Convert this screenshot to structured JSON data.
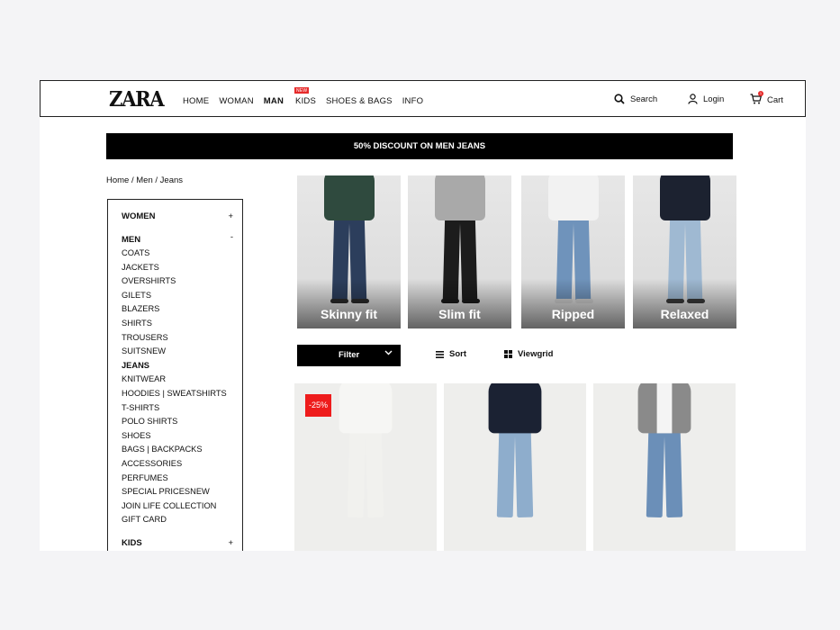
{
  "brand": "ZARA",
  "nav": {
    "items": [
      {
        "label": "HOME",
        "active": false
      },
      {
        "label": "WOMAN",
        "active": false
      },
      {
        "label": "MAN",
        "active": true
      },
      {
        "label": "KIDS",
        "active": false,
        "badge": "NEW"
      },
      {
        "label": "SHOES & BAGS",
        "active": false
      },
      {
        "label": "INFO",
        "active": false
      }
    ]
  },
  "header_actions": {
    "search": "Search",
    "login": "Login",
    "cart": "Cart",
    "cart_count": "1"
  },
  "promo": "50% DISCOUNT ON MEN JEANS",
  "breadcrumb": [
    "Home",
    "Men",
    "Jeans"
  ],
  "breadcrumb_sep": " / ",
  "sidebar": {
    "women": {
      "label": "WOMEN",
      "sign": "+"
    },
    "men": {
      "label": "MEN",
      "sign": "-"
    },
    "men_items": [
      "COATS",
      "JACKETS",
      "OVERSHIRTS",
      "GILETS",
      "BLAZERS",
      "SHIRTS",
      "TROUSERS",
      "SUITSNEW",
      "JEANS",
      "KNITWEAR",
      "HOODIES | SWEATSHIRTS",
      "T-SHIRTS",
      "POLO SHIRTS",
      "SHOES",
      "BAGS | BACKPACKS",
      "ACCESSORIES",
      "PERFUMES",
      "SPECIAL PRICESNEW",
      "JOIN LIFE COLLECTION",
      "GIFT CARD"
    ],
    "current_item": "JEANS",
    "kids": {
      "label": "KIDS",
      "sign": "+"
    }
  },
  "categories": [
    {
      "label": "Skinny fit",
      "top": "#2f4a3e",
      "jeans": "#2c3e5c",
      "shoe": "#2a2a2a"
    },
    {
      "label": "Slim fit",
      "top": "#a9a9a9",
      "jeans": "#1c1c1c",
      "shoe": "#1a1a1a"
    },
    {
      "label": "Ripped",
      "top": "#f2f2f2",
      "jeans": "#6f93bb",
      "shoe": "#cfcfcf"
    },
    {
      "label": "Relaxed",
      "top": "#1c2230",
      "jeans": "#9fb9d2",
      "shoe": "#3a3a3a"
    }
  ],
  "toolbar": {
    "filter": "Filter",
    "filter_icon": "chevron-down-icon",
    "sort": "Sort",
    "sort_icon": "list-icon",
    "view": "Viewgrid",
    "view_icon": "grid-icon"
  },
  "products": [
    {
      "discount": "-25%",
      "top": "#f6f6f4",
      "jeans": "#f1f1ee"
    },
    {
      "discount": "",
      "top": "#1b2233",
      "jeans": "#8eadcc"
    },
    {
      "discount": "",
      "top": "#8a8a8a",
      "inner": "#f4f4f4",
      "jeans": "#6b8fb8"
    }
  ]
}
